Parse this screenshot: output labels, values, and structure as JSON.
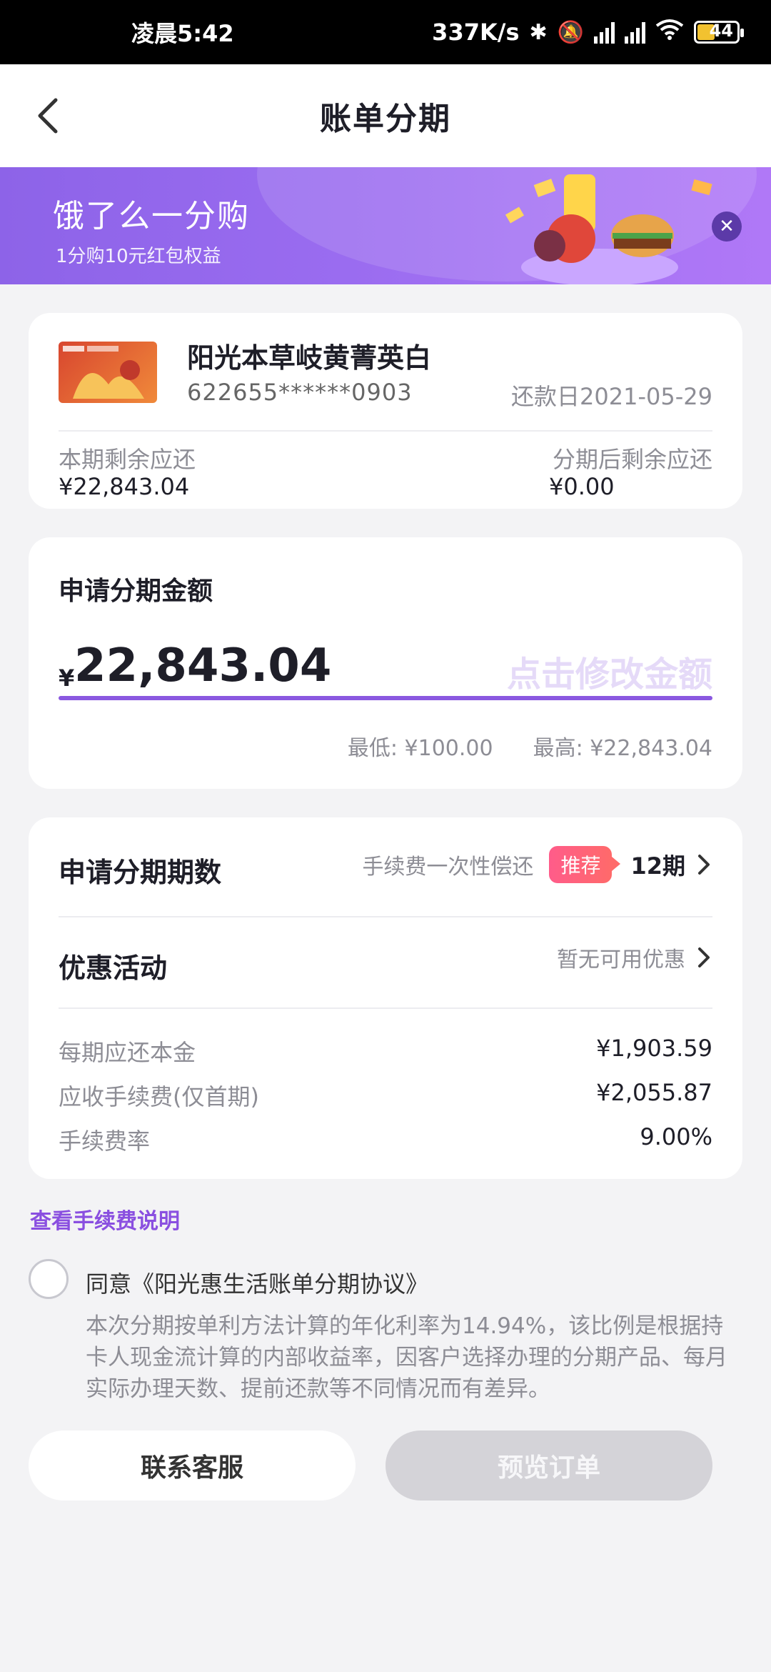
{
  "status_bar": {
    "time": "凌晨5:42",
    "net_speed": "337K/s",
    "battery": "44"
  },
  "header": {
    "title": "账单分期"
  },
  "banner": {
    "title": "饿了么一分购",
    "subtitle": "1分购10元红包权益"
  },
  "card_info": {
    "name": "阳光本草岐黄菁英白",
    "number": "622655******0903",
    "repay_day": "还款日2021-05-29",
    "remaining_label": "本期剩余应还",
    "remaining_value": "¥22,843.04",
    "after_label": "分期后剩余应还",
    "after_value": "¥0.00"
  },
  "amount": {
    "title": "申请分期金额",
    "currency": "¥",
    "value": "22,843.04",
    "edit_hint": "点击修改金额",
    "min": "最低: ¥100.00",
    "max": "最高: ¥22,843.04"
  },
  "installment": {
    "periods_label": "申请分期期数",
    "fee_mode": "手续费一次性偿还",
    "badge": "推荐",
    "periods_value": "12期",
    "promo_label": "优惠活动",
    "promo_value": "暂无可用优惠",
    "details": [
      {
        "k": "每期应还本金",
        "v": "¥1,903.59"
      },
      {
        "k": "应收手续费(仅首期)",
        "v": "¥2,055.87"
      },
      {
        "k": "手续费率",
        "v": "9.00%"
      }
    ]
  },
  "fee_link": "查看手续费说明",
  "agreement": {
    "text": "同意《阳光惠生活账单分期协议》",
    "desc": "本次分期按单利方法计算的年化利率为14.94%，该比例是根据持卡人现金流计算的内部收益率，因客户选择办理的分期产品、每月实际办理天数、提前还款等不同情况而有差异。"
  },
  "buttons": {
    "contact": "联系客服",
    "preview": "预览订单"
  },
  "colors": {
    "accent": "#8a58e0",
    "badge": "#ff5c8a",
    "disabled": "#d4d3d8"
  }
}
